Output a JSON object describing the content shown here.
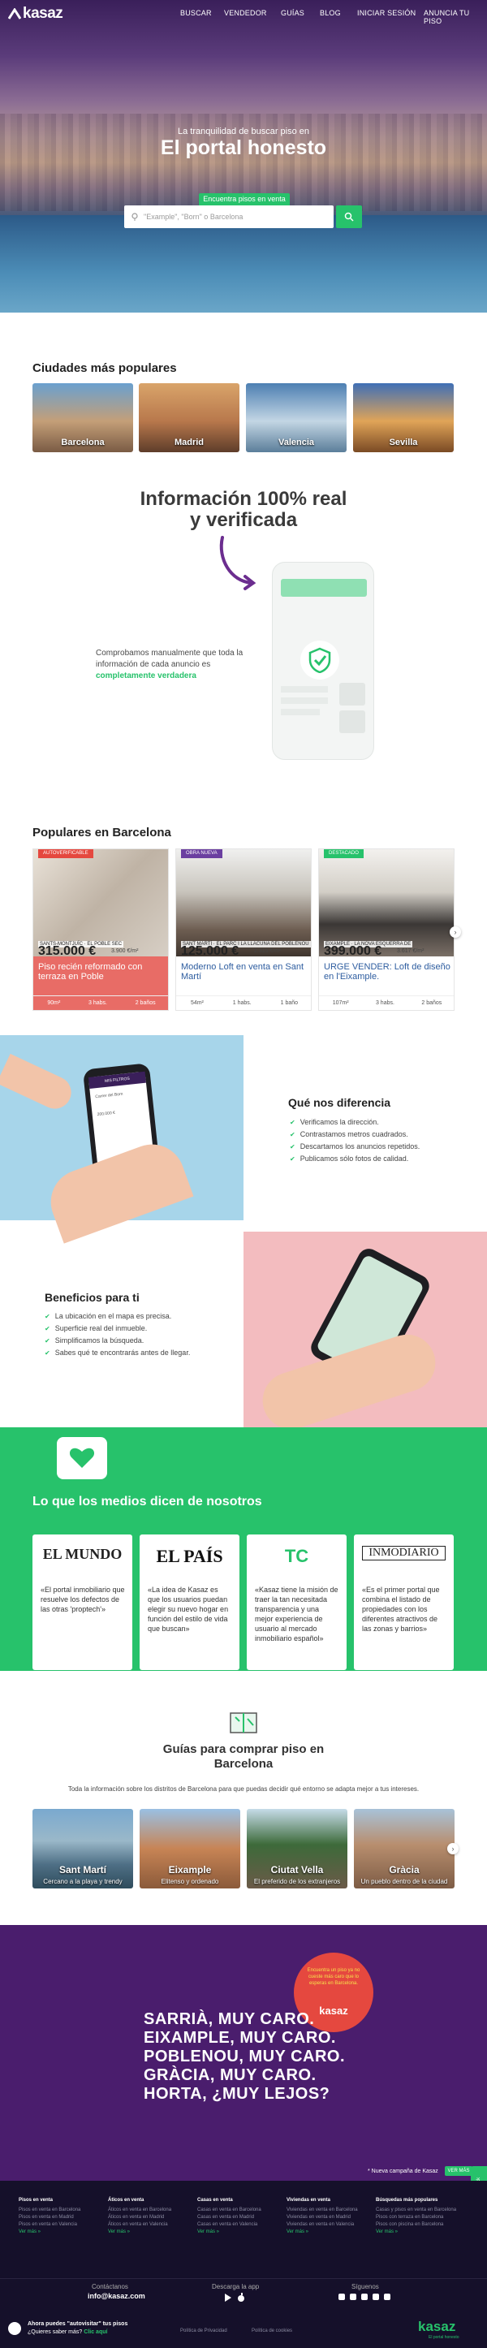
{
  "header": {
    "brand": "kasaz",
    "nav": [
      "BUSCAR",
      "VENDEDOR",
      "GUÍAS",
      "BLOG",
      "INICIAR SESIÓN",
      "ANUNCIA TU PISO"
    ]
  },
  "hero": {
    "subtitle": "La tranquilidad de buscar piso en",
    "title": "El portal honesto",
    "search_tab": "Encuentra pisos en venta en",
    "search_placeholder": "\"Example\", \"Born\" o Barcelona"
  },
  "cities": {
    "title": "Ciudades más populares",
    "items": [
      "Barcelona",
      "Madrid",
      "Valencia",
      "Sevilla"
    ]
  },
  "info": {
    "title_line1": "Información 100% real",
    "title_line2": "y verificada",
    "text": "Comprobamos manualmente que toda la información de cada anuncio es ",
    "highlight": "completamente verdadera"
  },
  "popular": {
    "title": "Populares en Barcelona",
    "cards": [
      {
        "badge": "AUTOVERIFICABLE",
        "address": "SANTS-MONTJUÏC · EL POBLE SEC",
        "price": "315.000 €",
        "m2": "3.900 €/m²",
        "title": "Piso recién reformado con terraza en Poble",
        "features": [
          "90m²",
          "3 habs.",
          "2 baños"
        ]
      },
      {
        "badge": "OBRA NUEVA",
        "address": "SANT MARTÍ · EL PARC I LA LLACUNA DEL POBLENOU",
        "price": "125.000 €",
        "m2": "2.315 €/m²",
        "title": "Moderno Loft en venta en Sant Martí",
        "features": [
          "54m²",
          "1 habs.",
          "1 baño"
        ]
      },
      {
        "badge": "DESTACADO",
        "address": "EIXAMPLE · LA NOVA ESQUERRA DE",
        "price": "399.000 €",
        "m2": "3.617 €/m²",
        "title": "URGE VENDER: Loft de diseño en l'Eixample.",
        "features": [
          "107m²",
          "3 habs.",
          "2 baños"
        ]
      }
    ]
  },
  "difference": {
    "title": "Qué nos diferencia",
    "items": [
      "Verificamos la dirección.",
      "Contrastamos metros cuadrados.",
      "Descartamos los anuncios repetidos.",
      "Publicamos sólo fotos de calidad."
    ],
    "phone_header": "MIS FILTROS",
    "phone_field": "Carrer del Born",
    "phone_price": "200.000 €"
  },
  "benefits": {
    "title": "Beneficios para ti",
    "items": [
      "La ubicación en el mapa es precisa.",
      "Superficie real del inmueble.",
      "Simplificamos la búsqueda.",
      "Sabes qué te encontrarás antes de llegar."
    ]
  },
  "media": {
    "title": "Lo que los medios dicen de nosotros",
    "cards": [
      {
        "logo": "EL MUNDO",
        "quote": "«El portal inmobiliario que resuelve los defectos de las otras 'proptech'»"
      },
      {
        "logo": "EL PAÍS",
        "quote": "«La idea de Kasaz es que los usuarios puedan elegir su nuevo hogar en función del estilo de vida que buscan»"
      },
      {
        "logo": "TC",
        "quote": "«Kasaz tiene la misión de traer la tan necesitada transparencia y una mejor experiencia de usuario al mercado inmobiliario español»"
      },
      {
        "logo": "INMODIARIO",
        "quote": "«Es el primer portal que combina el listado de propiedades con los diferentes atractivos de las zonas y barrios»"
      }
    ]
  },
  "guides": {
    "title_line1": "Guías para comprar piso en",
    "title_line2": "Barcelona",
    "subtitle": "Toda la información sobre los distritos de Barcelona para que puedas decidir qué entorno se adapta mejor a tus intereses.",
    "items": [
      {
        "name": "Sant Martí",
        "desc": "Cercano a la playa y trendy"
      },
      {
        "name": "Eixample",
        "desc": "Elitenso y ordenado"
      },
      {
        "name": "Ciutat Vella",
        "desc": "El preferido de los extranjeros"
      },
      {
        "name": "Gràcia",
        "desc": "Un pueblo dentro de la ciudad"
      }
    ]
  },
  "campaign": {
    "lines": [
      "SARRIÀ, MUY CARO.",
      "EIXAMPLE, MUY CARO.",
      "POBLENOU, MUY CARO.",
      "GRÀCIA, MUY CARO.",
      "HORTA, ¿MUY LEJOS?"
    ],
    "badge_text": "Encuentra un piso ya no cueste más caro que lo esperas en Barcelona.",
    "badge_brand": "kasaz",
    "note": "* Nueva campaña de Kasaz",
    "btn": "VER MÁS",
    "side_tab": "Feedback"
  },
  "footer": {
    "columns": [
      {
        "title": "Pisos en venta",
        "links": [
          "Pisos en venta en Barcelona",
          "Pisos en venta en Madrid",
          "Pisos en venta en Valencia"
        ],
        "more": "Ver más »"
      },
      {
        "title": "Áticos en venta",
        "links": [
          "Áticos en venta en Barcelona",
          "Áticos en venta en Madrid",
          "Áticos en venta en Valencia"
        ],
        "more": "Ver más »"
      },
      {
        "title": "Casas en venta",
        "links": [
          "Casas en venta en Barcelona",
          "Casas en venta en Madrid",
          "Casas en venta en Valencia"
        ],
        "more": "Ver más »"
      },
      {
        "title": "Viviendas en venta",
        "links": [
          "Viviendas en venta en Barcelona",
          "Viviendas en venta en Madrid",
          "Viviendas en venta en Valencia"
        ],
        "more": "Ver más »"
      },
      {
        "title": "Búsquedas más populares",
        "links": [
          "Casas y pisos en venta en Barcelona",
          "Pisos con terraza en Barcelona",
          "Pisos con piscina en Barcelona"
        ],
        "more": "Ver más »"
      }
    ],
    "contact_label": "Contáctanos",
    "email": "info@kasaz.com",
    "app_label": "Descarga la app",
    "follow_label": "Síguenos",
    "notice_line1": "Ahora puedes \"autovisitar\" tus pisos",
    "notice_line2": "¿Quieres saber más?",
    "notice_link": "Clic aquí",
    "privacy": "Política de Privacidad",
    "cookies": "Política de cookies",
    "brand": "kasaz",
    "brand_sub": "El portal honesto",
    "colors": {
      "green": "#27c26b",
      "purple": "#4a1d6d",
      "dark": "#15102a"
    }
  }
}
